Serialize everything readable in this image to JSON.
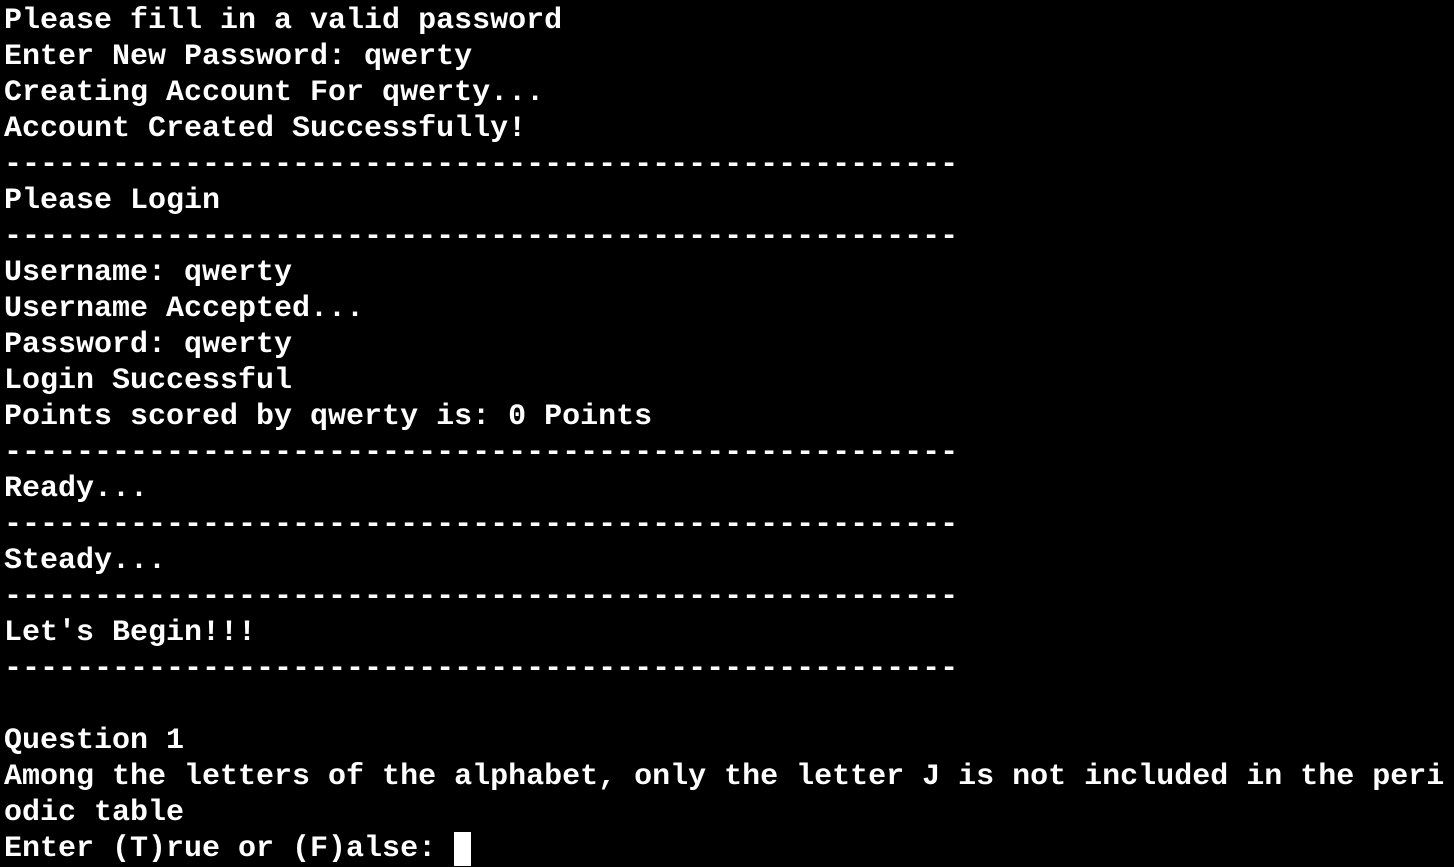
{
  "terminal": {
    "lines": [
      "Please fill in a valid password",
      "Enter New Password: qwerty",
      "Creating Account For qwerty...",
      "Account Created Successfully!",
      "-----------------------------------------------------",
      "Please Login",
      "-----------------------------------------------------",
      "Username: qwerty",
      "Username Accepted...",
      "Password: qwerty",
      "Login Successful",
      "Points scored by qwerty is: 0 Points",
      "-----------------------------------------------------",
      "Ready...",
      "-----------------------------------------------------",
      "Steady...",
      "-----------------------------------------------------",
      "Let's Begin!!!",
      "-----------------------------------------------------",
      "",
      "Question 1",
      "Among the letters of the alphabet, only the letter J is not included in the peri",
      "odic table"
    ],
    "prompt": "Enter (T)rue or (F)alse: ",
    "input_value": ""
  },
  "colors": {
    "background": "#000000",
    "foreground": "#ffffff"
  }
}
